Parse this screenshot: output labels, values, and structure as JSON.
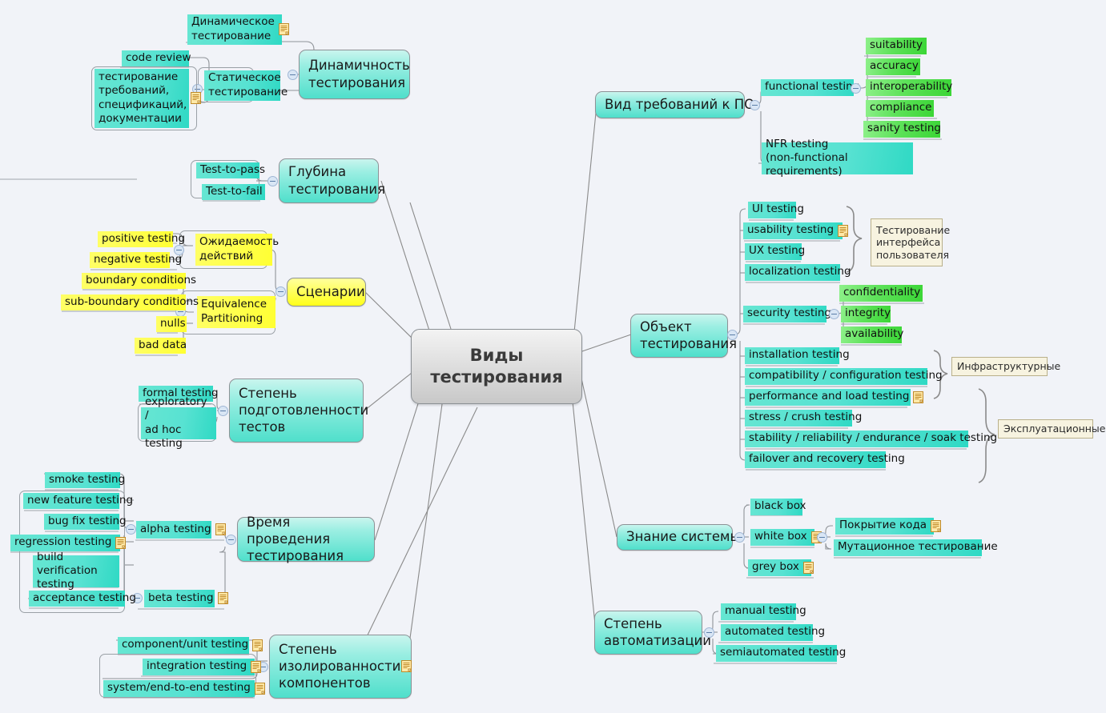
{
  "meta": {
    "background_color": "#f1f3f8",
    "accent_teal": "#4fdfcb",
    "accent_green": "#5ee25a",
    "accent_yellow": "#ffff33",
    "callout_bg": "#f7f3e0",
    "central_fill": "#d8d8d8"
  },
  "central": {
    "title": "Виды\nтестирования"
  },
  "branches": {
    "dynamic": {
      "label": "Динамичность\nтестирования",
      "children": [
        {
          "label": "Динамическое\nтестирование",
          "note": true
        },
        {
          "label": "Статическое\nтестирование",
          "note": false,
          "children": [
            {
              "label": "code review",
              "note": false
            },
            {
              "label": "тестирование\nтребований,\nспецификаций,\nдокументации",
              "note": true
            }
          ]
        }
      ]
    },
    "depth": {
      "label": "Глубина\nтестирования",
      "children": [
        {
          "label": "Test-to-pass"
        },
        {
          "label": "Test-to-fail"
        }
      ]
    },
    "scenarios": {
      "label": "Сценарии",
      "children": [
        {
          "label": "Ожидаемость\nдействий",
          "children": [
            {
              "label": "positive testing"
            },
            {
              "label": "negative testing"
            }
          ]
        },
        {
          "label": "Equivalence\nPartitioning",
          "children": [
            {
              "label": "boundary conditions"
            },
            {
              "label": "sub-boundary conditions"
            },
            {
              "label": "nulls"
            },
            {
              "label": "bad data"
            }
          ]
        }
      ]
    },
    "readiness": {
      "label": "Степень\nподготовленности\nтестов",
      "children": [
        {
          "label": "formal testing"
        },
        {
          "label": "exploratory /\nad hoc testing"
        }
      ]
    },
    "timing": {
      "label": "Время проведения\nтестирования",
      "children": [
        {
          "label": "alpha testing",
          "note": true,
          "children": [
            {
              "label": "smoke testing"
            },
            {
              "label": "new feature testing"
            },
            {
              "label": "bug fix testing"
            },
            {
              "label": "regression testing",
              "note": true
            },
            {
              "label": "build verification\ntesting"
            }
          ]
        },
        {
          "label": "beta testing",
          "note": true,
          "children": [
            {
              "label": "acceptance testing"
            }
          ]
        }
      ]
    },
    "isolation": {
      "label": "Степень\nизолированности\nкомпонентов",
      "note": true,
      "children": [
        {
          "label": "component/unit testing",
          "note": true
        },
        {
          "label": "integration testing",
          "note": true
        },
        {
          "label": "system/end-to-end testing",
          "note": true
        }
      ]
    },
    "requirements": {
      "label": "Вид требований к ПО",
      "children": [
        {
          "label": "functional testing",
          "children": [
            {
              "label": "suitability",
              "color": "green"
            },
            {
              "label": "accuracy",
              "color": "green"
            },
            {
              "label": "interoperability",
              "color": "green"
            },
            {
              "label": "compliance",
              "color": "green"
            },
            {
              "label": "sanity testing",
              "color": "green"
            }
          ]
        },
        {
          "label": "NFR testing\n(non-functional requirements)"
        }
      ]
    },
    "object": {
      "label": "Объект\nтестирования",
      "children": [
        {
          "label": "UI testing"
        },
        {
          "label": "usability testing",
          "note": true
        },
        {
          "label": "UX testing"
        },
        {
          "label": "localization testing"
        },
        {
          "label": "security testing",
          "children": [
            {
              "label": "confidentiality",
              "color": "green"
            },
            {
              "label": "integrity",
              "color": "green"
            },
            {
              "label": "availability",
              "color": "green"
            }
          ]
        },
        {
          "label": "installation testing"
        },
        {
          "label": "compatibility / configuration testing"
        },
        {
          "label": "performance and load testing",
          "note": true
        },
        {
          "label": "stress / crush testing"
        },
        {
          "label": "stability / reliability / endurance / soak testing"
        },
        {
          "label": "failover and recovery testing"
        }
      ],
      "callouts": [
        {
          "label": "Тестирование\nинтерфейса\nпользователя"
        },
        {
          "label": "Инфраструктурные"
        },
        {
          "label": "Эксплуатационные"
        }
      ]
    },
    "knowledge": {
      "label": "Знание системы",
      "children": [
        {
          "label": "black box"
        },
        {
          "label": "white box",
          "note": true,
          "children": [
            {
              "label": "Покрытие кода",
              "note": true
            },
            {
              "label": "Мутационное тестирование"
            }
          ]
        },
        {
          "label": "grey box",
          "note": true
        }
      ]
    },
    "automation": {
      "label": "Степень\nавтоматизации",
      "children": [
        {
          "label": "manual testing"
        },
        {
          "label": "automated testing"
        },
        {
          "label": "semiautomated testing"
        }
      ]
    }
  }
}
